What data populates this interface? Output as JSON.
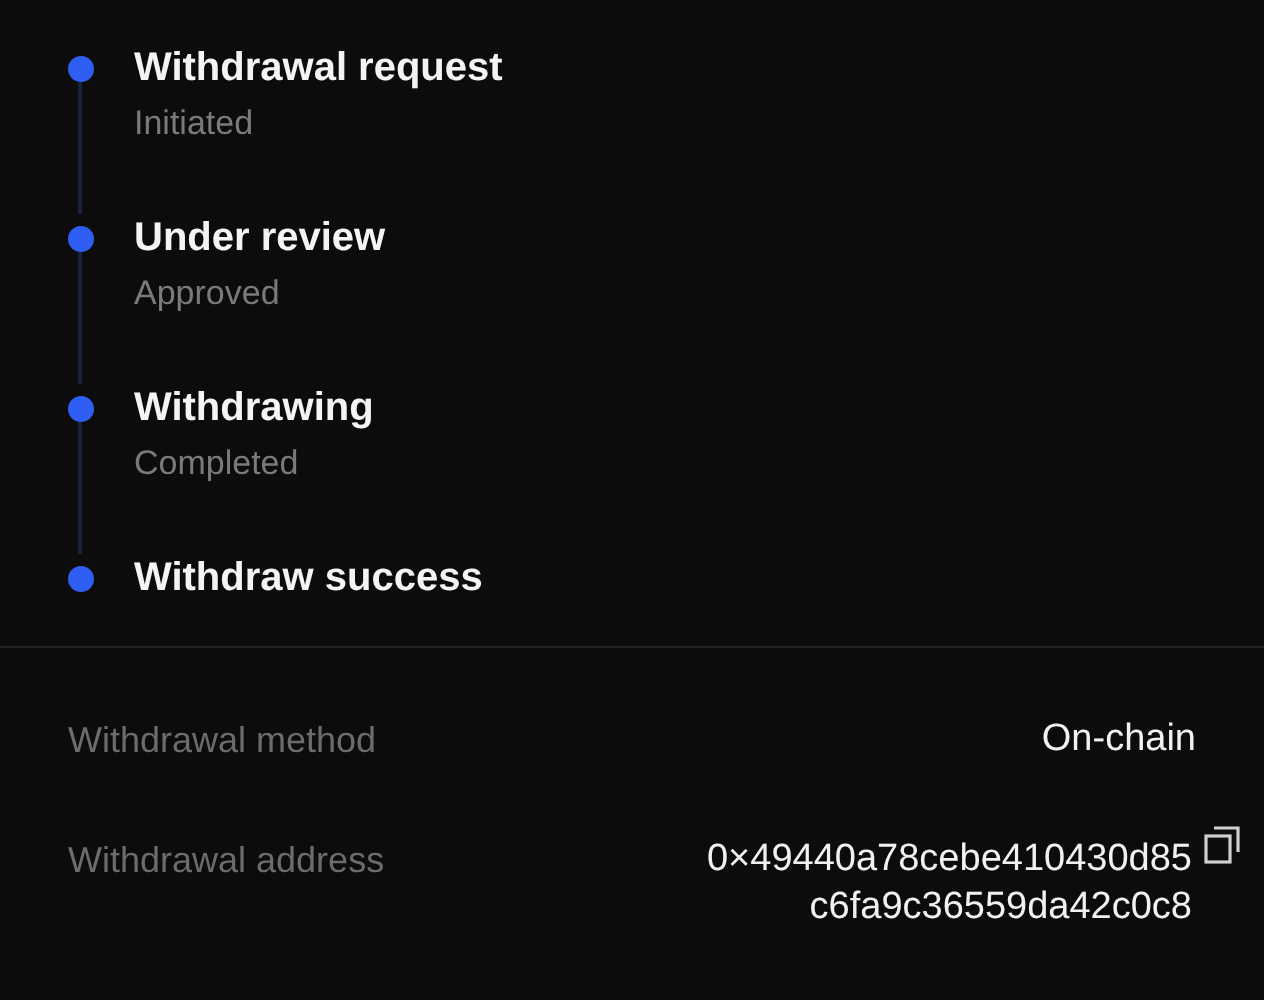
{
  "steps": [
    {
      "title": "Withdrawal request",
      "status": "Initiated"
    },
    {
      "title": "Under review",
      "status": "Approved"
    },
    {
      "title": "Withdrawing",
      "status": "Completed"
    },
    {
      "title": "Withdraw success"
    }
  ],
  "details": [
    {
      "label": "Withdrawal method",
      "value_lines": [
        "On-chain"
      ]
    },
    {
      "label": "Withdrawal address",
      "value_lines": [
        "0×49440a78cebe410430d85",
        "c6fa9c36559da42c0c8"
      ],
      "copyable": true
    }
  ]
}
